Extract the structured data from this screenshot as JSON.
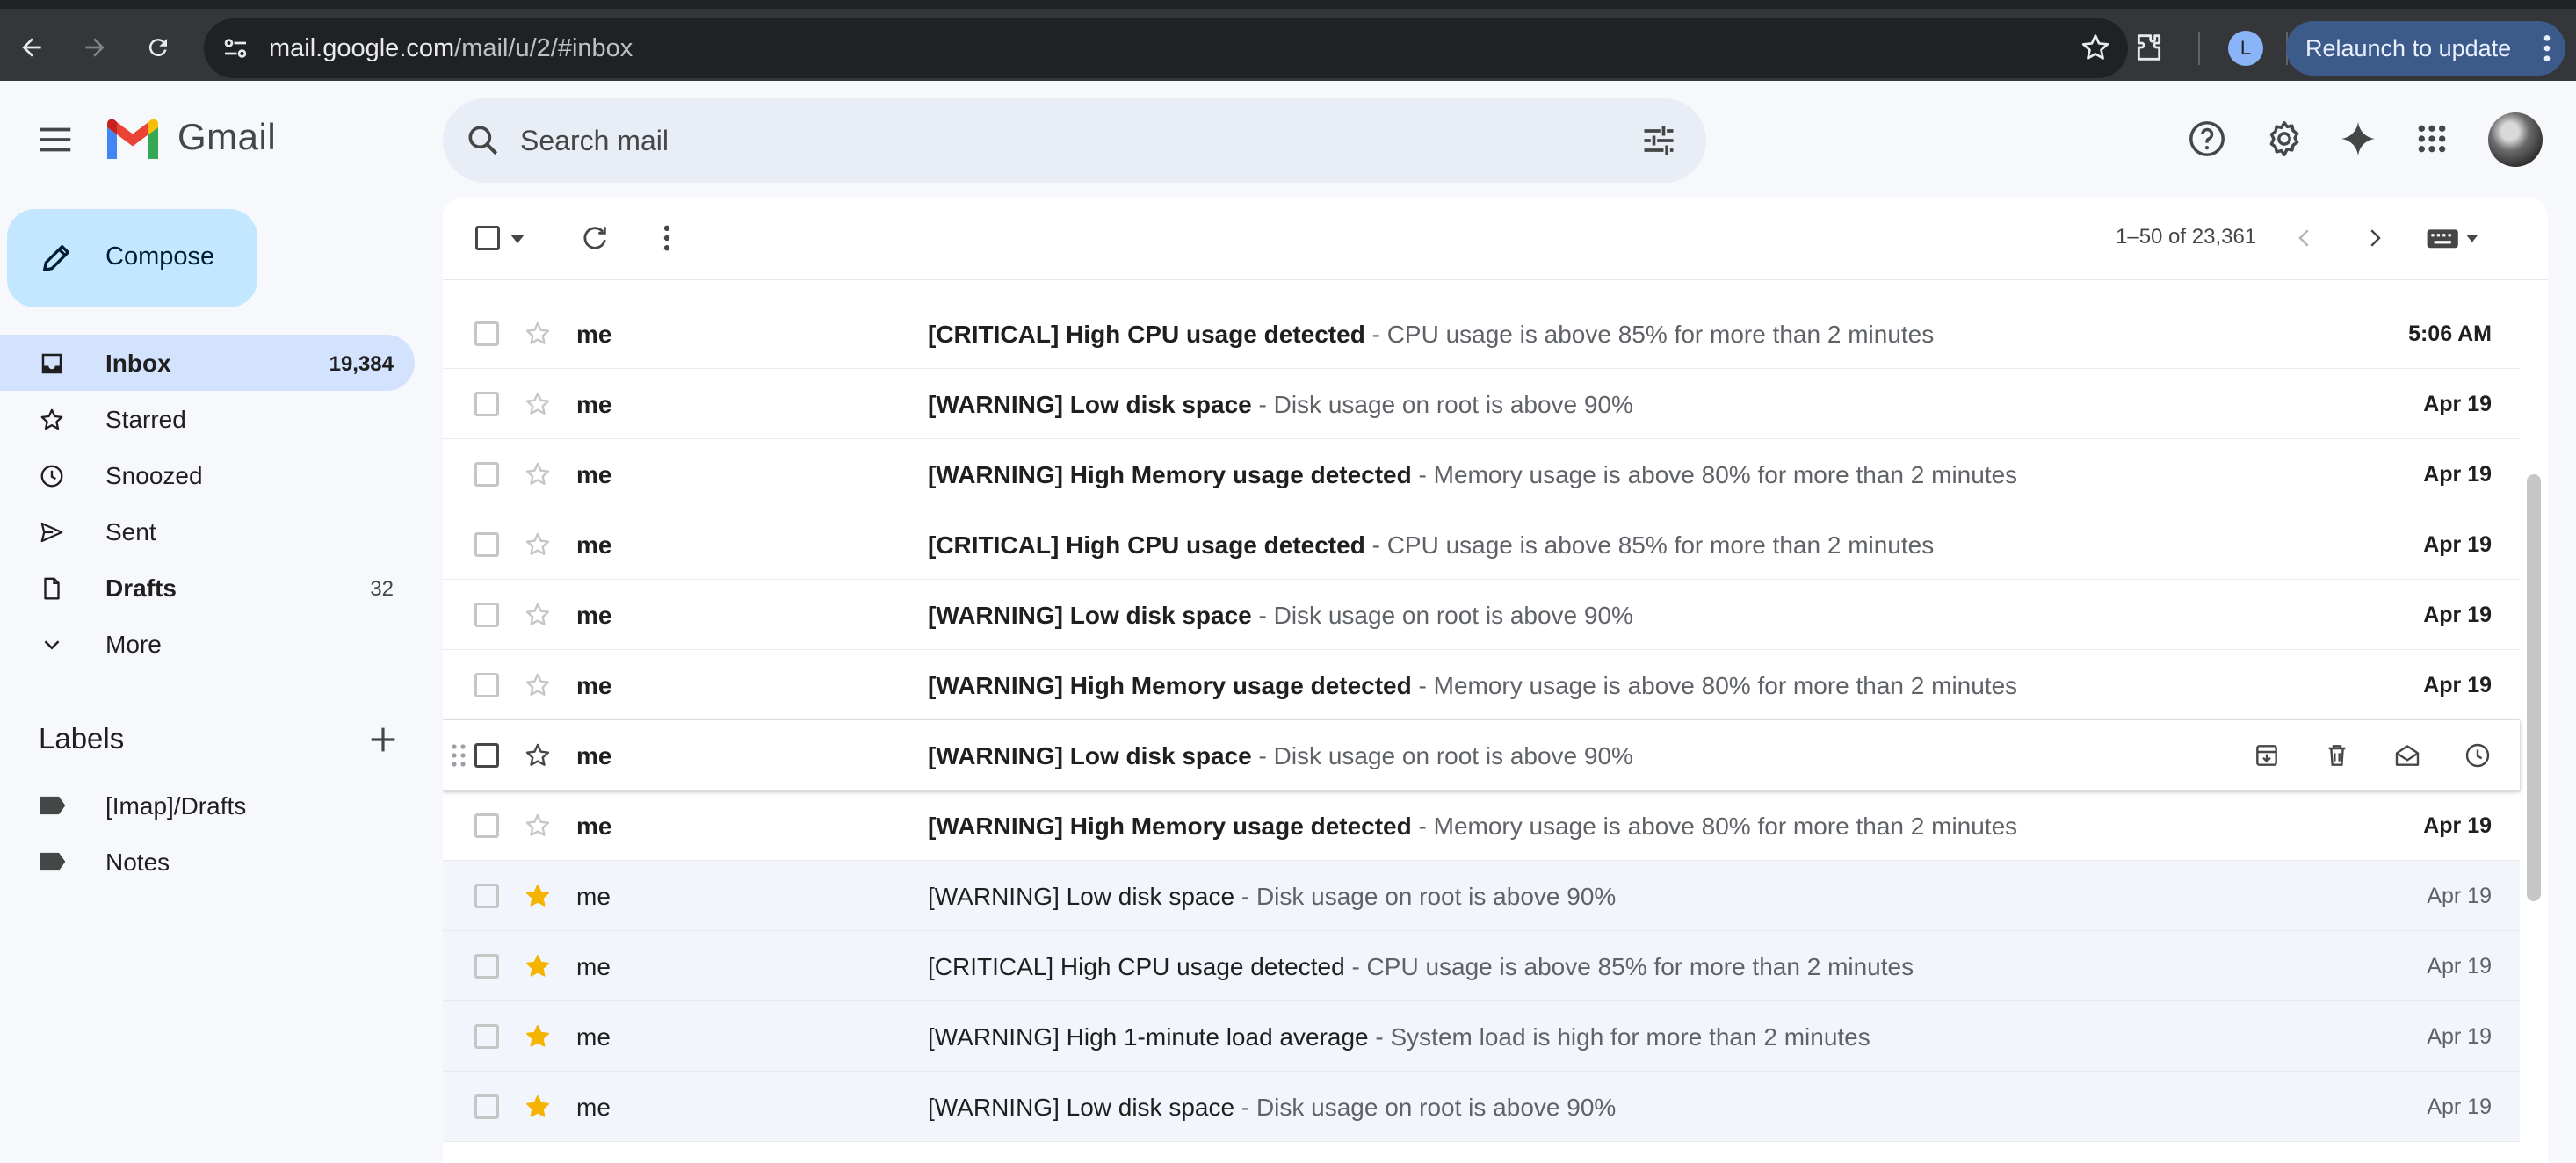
{
  "browser": {
    "url_host": "mail.google.com",
    "url_path": "/mail/u/2/#inbox",
    "profile_initial": "L",
    "relaunch_label": "Relaunch to update"
  },
  "app": {
    "name": "Gmail",
    "search_placeholder": "Search mail"
  },
  "sidebar": {
    "compose_label": "Compose",
    "items": [
      {
        "label": "Inbox",
        "count": "19,384",
        "icon": "inbox-icon",
        "active": true
      },
      {
        "label": "Starred",
        "count": "",
        "icon": "star-outline-icon"
      },
      {
        "label": "Snoozed",
        "count": "",
        "icon": "clock-icon"
      },
      {
        "label": "Sent",
        "count": "",
        "icon": "send-icon"
      },
      {
        "label": "Drafts",
        "count": "32",
        "icon": "draft-file-icon",
        "bold": true
      },
      {
        "label": "More",
        "count": "",
        "icon": "chevron-down-icon"
      }
    ],
    "labels_heading": "Labels",
    "labels": [
      {
        "label": "[Imap]/Drafts",
        "icon": "label-icon"
      },
      {
        "label": "Notes",
        "icon": "label-icon"
      }
    ]
  },
  "toolbar": {
    "pager_text": "1–50 of 23,361"
  },
  "emails": [
    {
      "sender": "me",
      "subject": "[CRITICAL] High CPU usage detected",
      "snippet": " - CPU usage is above 85% for more than 2 minutes",
      "date": "5:06 AM",
      "unread": true,
      "starred": false
    },
    {
      "sender": "me",
      "subject": "[WARNING] Low disk space",
      "snippet": " - Disk usage on root is above 90%",
      "date": "Apr 19",
      "unread": true,
      "starred": false
    },
    {
      "sender": "me",
      "subject": "[WARNING] High Memory usage detected",
      "snippet": " - Memory usage is above 80% for more than 2 minutes",
      "date": "Apr 19",
      "unread": true,
      "starred": false
    },
    {
      "sender": "me",
      "subject": "[CRITICAL] High CPU usage detected",
      "snippet": " - CPU usage is above 85% for more than 2 minutes",
      "date": "Apr 19",
      "unread": true,
      "starred": false
    },
    {
      "sender": "me",
      "subject": "[WARNING] Low disk space",
      "snippet": " - Disk usage on root is above 90%",
      "date": "Apr 19",
      "unread": true,
      "starred": false
    },
    {
      "sender": "me",
      "subject": "[WARNING] High Memory usage detected",
      "snippet": " - Memory usage is above 80% for more than 2 minutes",
      "date": "Apr 19",
      "unread": true,
      "starred": false
    },
    {
      "sender": "me",
      "subject": "[WARNING] Low disk space",
      "snippet": " - Disk usage on root is above 90%",
      "date": "",
      "unread": true,
      "starred": false,
      "hovered": true
    },
    {
      "sender": "me",
      "subject": "[WARNING] High Memory usage detected",
      "snippet": " - Memory usage is above 80% for more than 2 minutes",
      "date": "Apr 19",
      "unread": true,
      "starred": false
    },
    {
      "sender": "me",
      "subject": "[WARNING] Low disk space",
      "snippet": " - Disk usage on root is above 90%",
      "date": "Apr 19",
      "unread": false,
      "starred": true
    },
    {
      "sender": "me",
      "subject": "[CRITICAL] High CPU usage detected",
      "snippet": " - CPU usage is above 85% for more than 2 minutes",
      "date": "Apr 19",
      "unread": false,
      "starred": true
    },
    {
      "sender": "me",
      "subject": "[WARNING] High 1-minute load average",
      "snippet": " - System load is high for more than 2 minutes",
      "date": "Apr 19",
      "unread": false,
      "starred": true
    },
    {
      "sender": "me",
      "subject": "[WARNING] Low disk space",
      "snippet": " - Disk usage on root is above 90%",
      "date": "Apr 19",
      "unread": false,
      "starred": true
    }
  ],
  "colors": {
    "star_filled": "#f4b400",
    "active_nav": "#d3e3fd",
    "compose_bg": "#c2e7ff",
    "relaunch_bg": "#3c5a8a"
  }
}
